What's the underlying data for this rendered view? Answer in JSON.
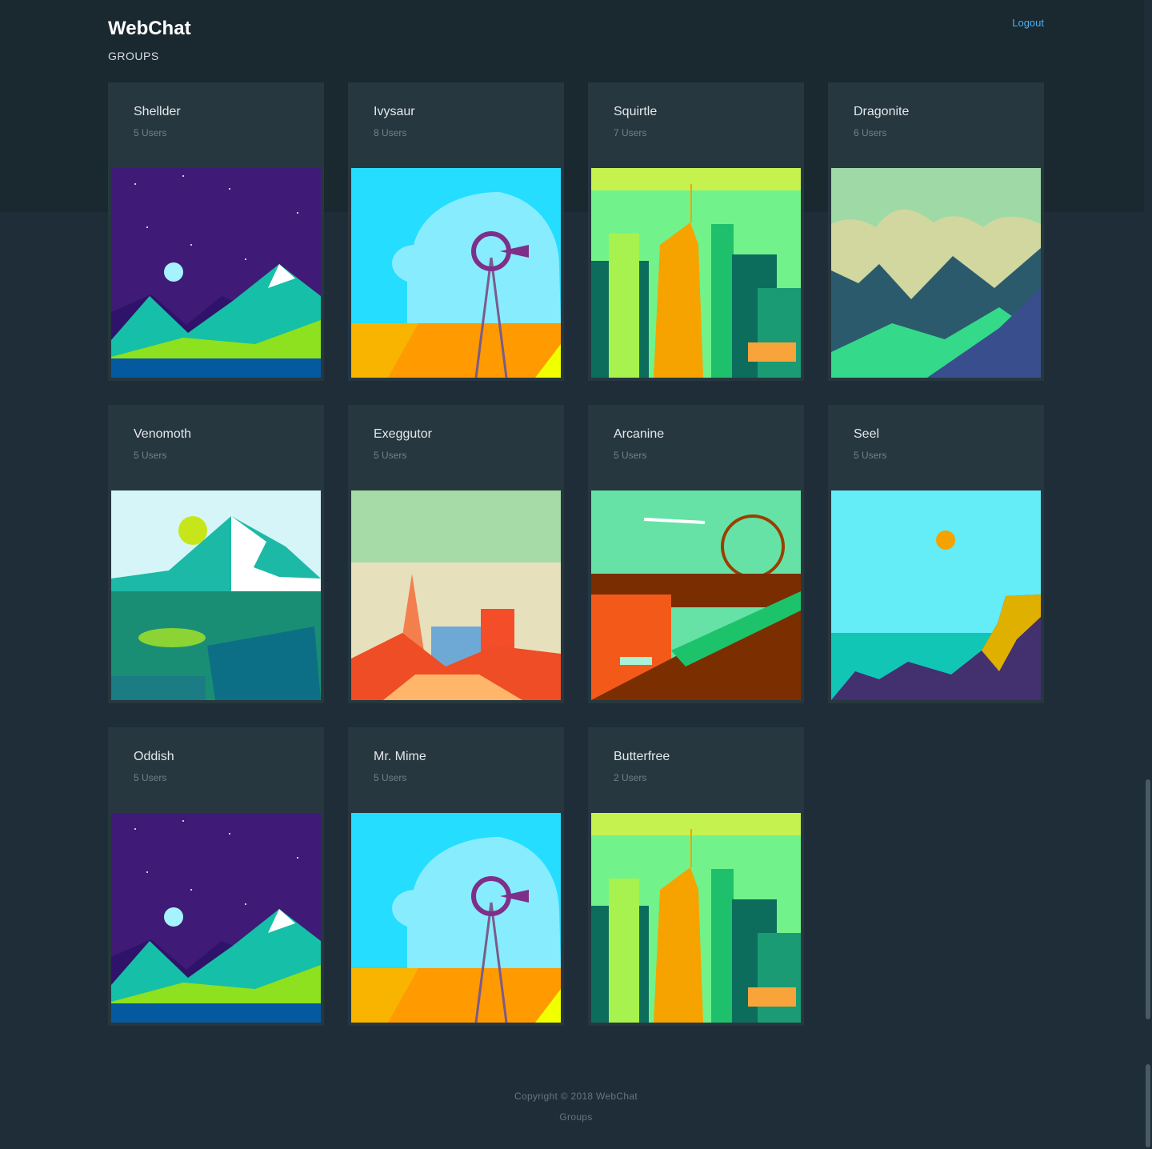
{
  "app": {
    "title": "WebChat"
  },
  "header": {
    "section_label": "GROUPS",
    "logout_label": "Logout"
  },
  "groups": [
    {
      "name": "Shellder",
      "users": "5 Users",
      "art": "night-mountains"
    },
    {
      "name": "Ivysaur",
      "users": "8 Users",
      "art": "windmill-field"
    },
    {
      "name": "Squirtle",
      "users": "7 Users",
      "art": "chicago-skyline"
    },
    {
      "name": "Dragonite",
      "users": "6 Users",
      "art": "mountain-valley"
    },
    {
      "name": "Venomoth",
      "users": "5 Users",
      "art": "seattle-sun"
    },
    {
      "name": "Exeggutor",
      "users": "5 Users",
      "art": "san-francisco"
    },
    {
      "name": "Arcanine",
      "users": "5 Users",
      "art": "london-eye"
    },
    {
      "name": "Seel",
      "users": "5 Users",
      "art": "sea-balloon"
    },
    {
      "name": "Oddish",
      "users": "5 Users",
      "art": "night-mountains"
    },
    {
      "name": "Mr. Mime",
      "users": "5 Users",
      "art": "windmill-field"
    },
    {
      "name": "Butterfree",
      "users": "2 Users",
      "art": "chicago-skyline"
    }
  ],
  "footer": {
    "copyright": "Copyright © 2018 WebChat",
    "link": "Groups"
  },
  "colors": {
    "background": "#1e2d38",
    "card": "#27373f",
    "accent": "#4fb0ef"
  }
}
